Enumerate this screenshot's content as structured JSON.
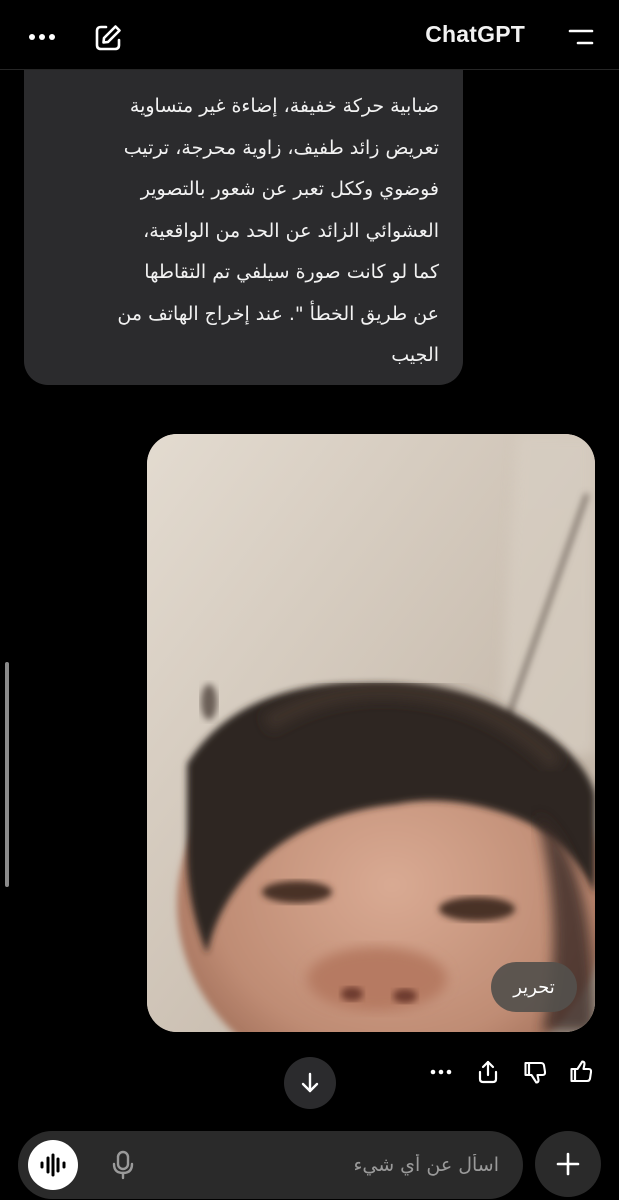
{
  "header": {
    "title": "ChatGPT",
    "more_icon": "more-horizontal-icon",
    "edit_icon": "new-chat-icon",
    "menu_icon": "sidebar-menu-icon"
  },
  "assistant_message": {
    "lines": [
      "ضبابية حركة خفيفة، إضاءة غير متساوية",
      "تعريض زائد طفيف، زاوية محرجة، ترتيب",
      "فوضوي وككل تعبر عن شعور بالتصوير",
      "العشوائي الزائد عن الحد من الواقعية،",
      "كما لو كانت صورة سيلفي تم التقاطها",
      "عن طريق الخطأ \". عند إخراج الهاتف من",
      "الجيب"
    ]
  },
  "user_message": {
    "image_subject": "blurry accidental selfie photo",
    "edit_label": "تحرير"
  },
  "actions": {
    "icons": [
      "more-icon",
      "share-icon",
      "thumbs-down-icon",
      "thumbs-up-icon"
    ]
  },
  "composer": {
    "placeholder": "اسأل عن أي شيء",
    "value": ""
  },
  "colors": {
    "background": "#000000",
    "bubble": "#2b2b2d",
    "composer": "#2a2a2a",
    "text": "#f2f2f2"
  }
}
